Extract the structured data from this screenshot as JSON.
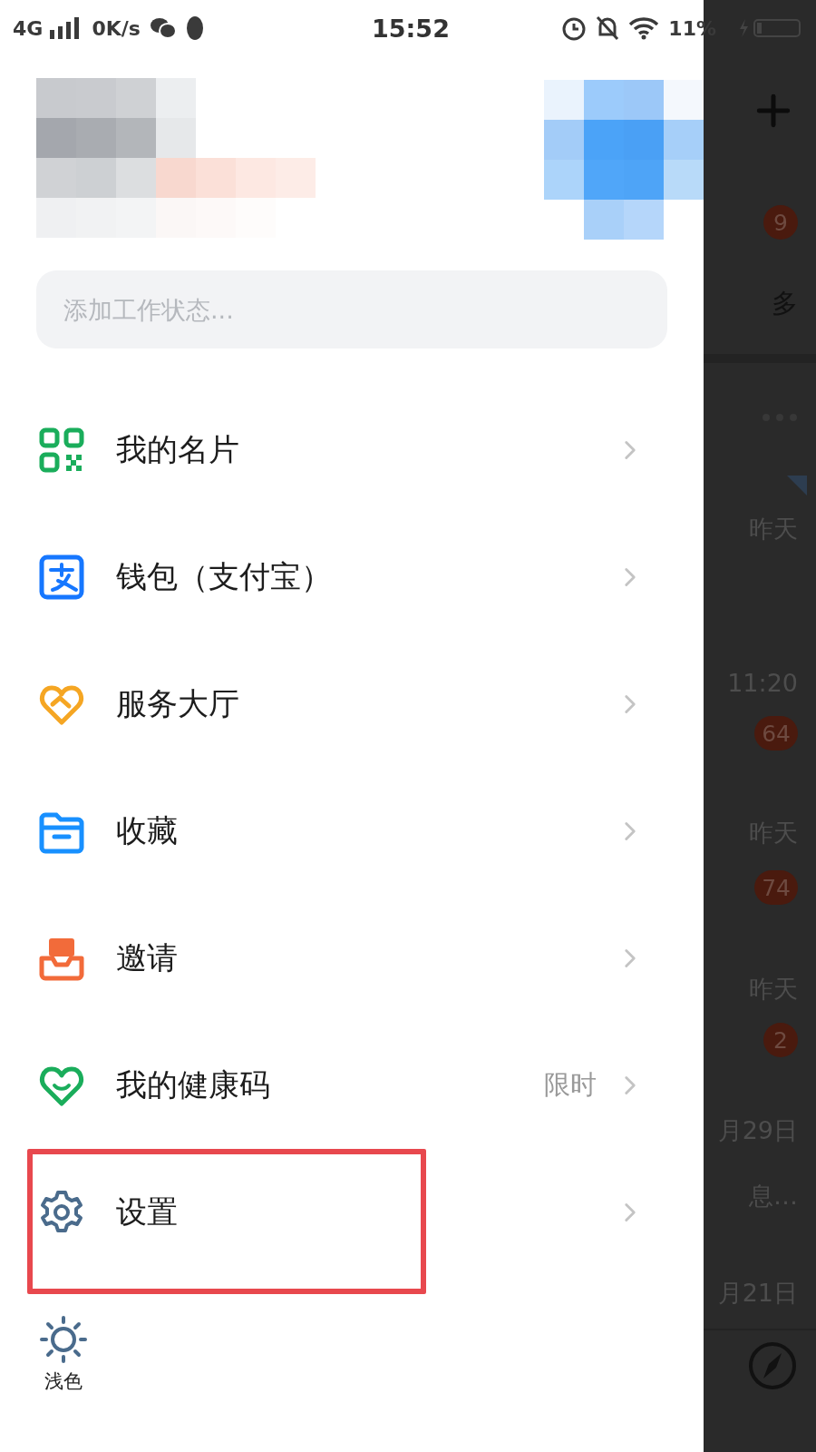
{
  "status_bar": {
    "network": "4G",
    "speed": "0K/s",
    "time": "15:52",
    "battery": "11%"
  },
  "status_input": {
    "placeholder": "添加工作状态..."
  },
  "menu": [
    {
      "label": "我的名片",
      "kind": "card",
      "highlighted": false
    },
    {
      "label": "钱包（支付宝）",
      "kind": "wallet",
      "highlighted": false
    },
    {
      "label": "服务大厅",
      "kind": "service",
      "highlighted": false
    },
    {
      "label": "收藏",
      "kind": "favorites",
      "highlighted": false
    },
    {
      "label": "邀请",
      "kind": "invite",
      "highlighted": false
    },
    {
      "label": "我的健康码",
      "kind": "health",
      "tag": "限时",
      "highlighted": false
    },
    {
      "label": "设置",
      "kind": "settings",
      "highlighted": true
    }
  ],
  "theme_toggle": {
    "label": "浅色"
  },
  "background_list": [
    {
      "kind": "add"
    },
    {
      "kind": "badge",
      "text": "9"
    },
    {
      "kind": "label",
      "text": "多"
    },
    {
      "kind": "divider"
    },
    {
      "kind": "dots"
    },
    {
      "kind": "corner"
    },
    {
      "kind": "time",
      "text": "昨天"
    },
    {
      "kind": "time",
      "text": "11:20"
    },
    {
      "kind": "badge",
      "text": "64"
    },
    {
      "kind": "time",
      "text": "昨天"
    },
    {
      "kind": "badge",
      "text": "74"
    },
    {
      "kind": "time",
      "text": "昨天"
    },
    {
      "kind": "badge",
      "text": "2"
    },
    {
      "kind": "time",
      "text": "月29日"
    },
    {
      "kind": "time",
      "text": "息…"
    },
    {
      "kind": "time",
      "text": "月21日"
    },
    {
      "kind": "divider"
    },
    {
      "kind": "compass"
    }
  ]
}
